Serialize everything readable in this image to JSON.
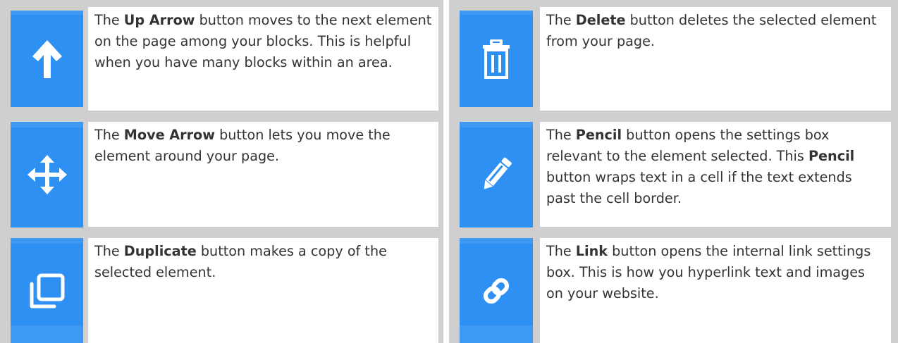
{
  "colors": {
    "accent": "#2e90f2",
    "frame": "#cfcfcf",
    "text": "#333333"
  },
  "items": [
    {
      "icon": "up-arrow-icon",
      "intro": "The ",
      "name": "Up Arrow",
      "desc": " button moves to the next element on the page among your blocks. This is helpful when you have many blocks within an area."
    },
    {
      "icon": "trash-icon",
      "intro": "The ",
      "name": "Delete",
      "desc": " button deletes the selected element from your page."
    },
    {
      "icon": "move-arrows-icon",
      "intro": "The ",
      "name": "Move Arrow",
      "desc": " button lets you move the element around your page."
    },
    {
      "icon": "pencil-icon",
      "intro": "The ",
      "name": "Pencil",
      "desc": " button opens the settings box relevant to the element selected. This ",
      "name2": "Pencil",
      "desc2": " button wraps text in a cell if the text extends past the cell border."
    },
    {
      "icon": "duplicate-icon",
      "intro": "The ",
      "name": "Duplicate",
      "desc": " button makes a copy of the selected element."
    },
    {
      "icon": "link-icon",
      "intro": "The ",
      "name": "Link",
      "desc": " button opens the internal link settings box. This is how you hyperlink text and images on your website."
    }
  ]
}
